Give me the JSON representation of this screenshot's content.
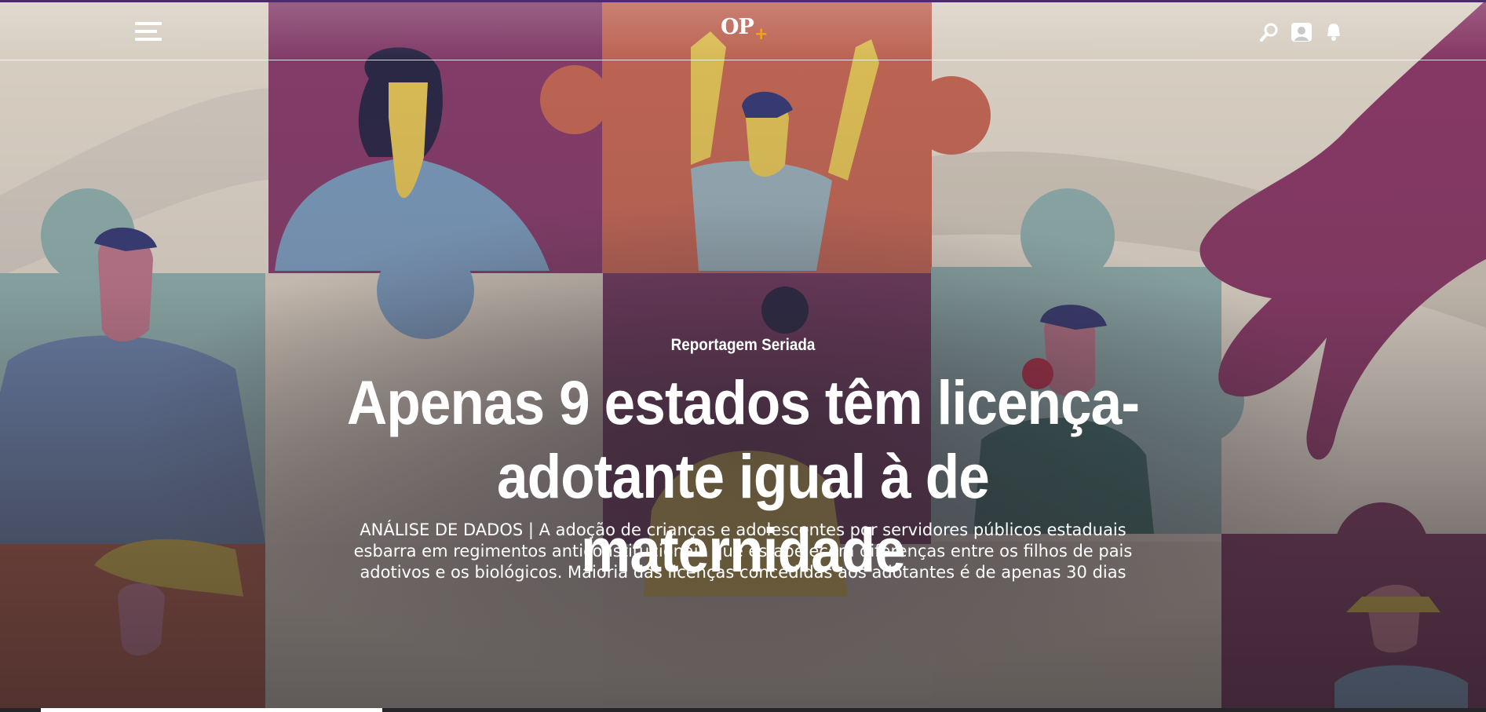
{
  "header": {
    "logo_text": "OP",
    "logo_plus": "+",
    "menu_icon": "hamburger-menu-icon",
    "icons": [
      "search-icon",
      "user-avatar-icon",
      "notification-bell-icon"
    ]
  },
  "article": {
    "kicker": "Reportagem Seriada",
    "headline": "Apenas 9 estados têm licença-adotante igual à de maternidade",
    "dek": "ANÁLISE DE DADOS | A adoção de crianças e adolescentes por servidores públicos estaduais esbarra em regimentos anticonstitucionais que estabelecem diferenças entre os filhos de pais adotivos e os biológicos. Maioria das licenças concedidas aos adotantes é de apenas 30 dias"
  },
  "reading_progress": 0.23,
  "colors": {
    "accent_top_bar": "#4b2a6e",
    "logo_plus": "#f4a11b",
    "puzzle_purple": "#8a3f6e",
    "puzzle_orange": "#c86a58",
    "puzzle_teal": "#8fb3b3",
    "puzzle_cream": "#e8ddd0"
  },
  "hero_image": "puzzle-pieces-people-illustration"
}
